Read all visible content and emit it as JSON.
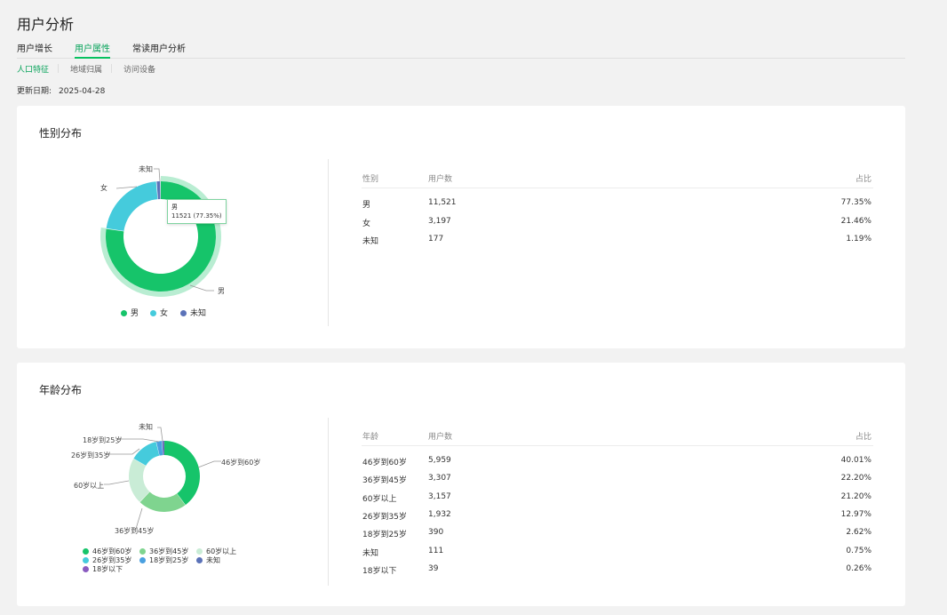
{
  "page_title": "用户分析",
  "tabs": [
    {
      "label": "用户增长"
    },
    {
      "label": "用户属性"
    },
    {
      "label": "常读用户分析"
    }
  ],
  "subtabs": [
    {
      "label": "人口特征"
    },
    {
      "label": "地域归属"
    },
    {
      "label": "访问设备"
    }
  ],
  "update": {
    "label": "更新日期:",
    "date": "2025-04-28"
  },
  "colors": {
    "accent": "#07c160",
    "male": "#16c46a",
    "female": "#45cbdc",
    "unknown": "#5b72b8"
  },
  "gender": {
    "title": "性别分布",
    "headers": {
      "col1": "性别",
      "col2": "用户数",
      "col3": "占比"
    },
    "rows": [
      {
        "name": "男",
        "count": "11,521",
        "pct": "77.35%"
      },
      {
        "name": "女",
        "count": "3,197",
        "pct": "21.46%"
      },
      {
        "name": "未知",
        "count": "177",
        "pct": "1.19%"
      }
    ],
    "tooltip": {
      "name": "男",
      "value": "11521 (77.35%)"
    },
    "legend": [
      "男",
      "女",
      "未知"
    ],
    "chart_labels": {
      "male": "男",
      "female": "女",
      "unknown": "未知"
    }
  },
  "age": {
    "title": "年龄分布",
    "headers": {
      "col1": "年龄",
      "col2": "用户数",
      "col3": "占比"
    },
    "rows": [
      {
        "name": "46岁到60岁",
        "count": "5,959",
        "pct": "40.01%"
      },
      {
        "name": "36岁到45岁",
        "count": "3,307",
        "pct": "22.20%"
      },
      {
        "name": "60岁以上",
        "count": "3,157",
        "pct": "21.20%"
      },
      {
        "name": "26岁到35岁",
        "count": "1,932",
        "pct": "12.97%"
      },
      {
        "name": "18岁到25岁",
        "count": "390",
        "pct": "2.62%"
      },
      {
        "name": "未知",
        "count": "111",
        "pct": "0.75%"
      },
      {
        "name": "18岁以下",
        "count": "39",
        "pct": "0.26%"
      }
    ],
    "legend": [
      "46岁到60岁",
      "36岁到45岁",
      "60岁以上",
      "26岁到35岁",
      "18岁到25岁",
      "未知",
      "18岁以下"
    ],
    "chart_labels": {
      "a46": "46岁到60岁",
      "a36": "36岁到45岁",
      "a60": "60岁以上",
      "a26": "26岁到35岁",
      "a18": "18岁到25岁",
      "unk": "未知"
    }
  },
  "chart_data": [
    {
      "type": "pie",
      "title": "性别分布",
      "categories": [
        "男",
        "女",
        "未知"
      ],
      "values": [
        11521,
        3197,
        177
      ],
      "colors": [
        "#16c46a",
        "#45cbdc",
        "#5b72b8"
      ]
    },
    {
      "type": "pie",
      "title": "年龄分布",
      "categories": [
        "46岁到60岁",
        "36岁到45岁",
        "60岁以上",
        "26岁到35岁",
        "18岁到25岁",
        "未知",
        "18岁以下"
      ],
      "values": [
        5959,
        3307,
        3157,
        1932,
        390,
        111,
        39
      ],
      "colors": [
        "#16c46a",
        "#7fd48f",
        "#c9ecd6",
        "#45cbdc",
        "#4aa0e0",
        "#5b72b8",
        "#8a5bc0"
      ]
    }
  ]
}
